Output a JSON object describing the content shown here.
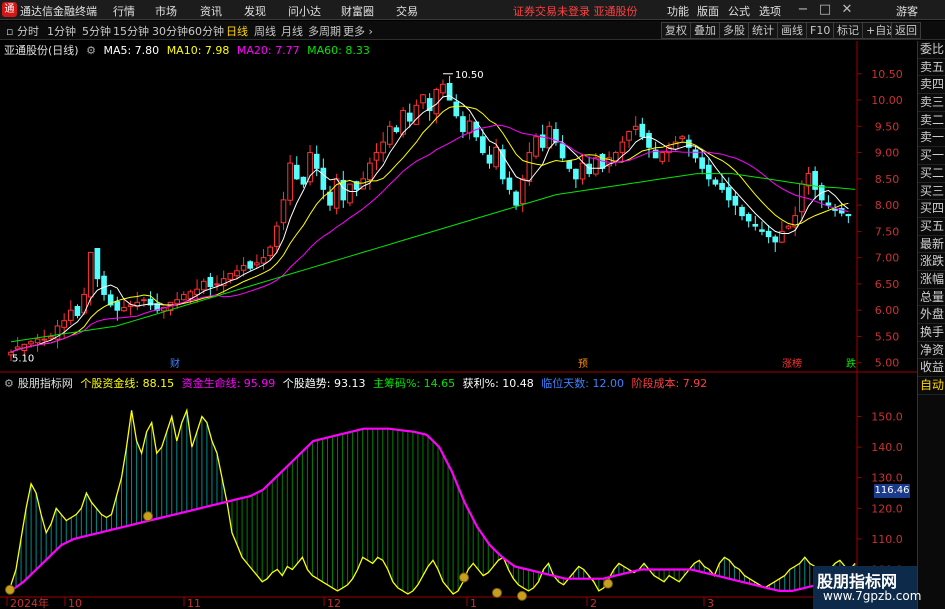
{
  "app": {
    "title": "通达信金融终端",
    "logo": "通"
  },
  "menu": [
    "行情",
    "市场",
    "资讯",
    "发现",
    "问小达",
    "财富圈",
    "交易"
  ],
  "login_warning": "证券交易未登录  亚通股份",
  "right_menu": [
    "功能",
    "版面",
    "公式",
    "选项"
  ],
  "guest": "游客",
  "window_icons": [
    "minimize-icon",
    "maximize-icon",
    "close-icon"
  ],
  "periods": [
    "分时",
    "1分钟",
    "5分钟",
    "15分钟",
    "30分钟",
    "60分钟",
    "日线",
    "周线",
    "月线",
    "多周期",
    "更多"
  ],
  "active_period": "日线",
  "toolbar": [
    "复权",
    "叠加",
    "多股",
    "统计",
    "画线",
    "F10",
    "标记",
    "+自选",
    "返回"
  ],
  "main_header": {
    "stock": "亚通股份",
    "period": "(日线)",
    "ma5": "MA5: 7.80",
    "ma10": "MA10: 7.98",
    "ma20": "MA20: 7.77",
    "ma60": "MA60: 8.33"
  },
  "colors": {
    "up": "#ff3232",
    "down": "#54fcfc",
    "ma5": "#ffffff",
    "ma10": "#ffff00",
    "ma20": "#ff00ff",
    "ma60": "#00e600"
  },
  "indicator_header": {
    "name": "股朋指标网",
    "f1": "个股资金线: 88.15",
    "f2": "资金生命线: 95.99",
    "f3": "个股趋势: 93.13",
    "f4": "主筹码%: 14.65",
    "f5": "获利%: 10.48",
    "f6": "临位天数: 12.00",
    "f7": "阶段成本: 7.92"
  },
  "right_panel": [
    "委比",
    "卖五",
    "卖四",
    "卖三",
    "卖二",
    "卖一",
    "买一",
    "买二",
    "买三",
    "买四",
    "买五",
    "最新",
    "涨跌",
    "涨幅",
    "总量",
    "外盘",
    "换手",
    "净资",
    "收益",
    "自动"
  ],
  "price_ticks": [
    "10.50",
    "10.00",
    "9.50",
    "9.00",
    "8.50",
    "8.00",
    "7.50",
    "7.00",
    "6.50",
    "6.00",
    "5.50",
    "5.00"
  ],
  "indicator_ticks": [
    "150.0",
    "140.0",
    "130.0",
    "120.0",
    "110.0",
    "100.0"
  ],
  "indicator_price_tag": "116.46",
  "date_labels": [
    "2024年",
    "10",
    "11",
    "12",
    "1",
    "2",
    "3"
  ],
  "annotations": {
    "high": "10.50",
    "low": "5.10",
    "cai": "财",
    "yu": "预",
    "zhangting": "涨榜",
    "die": "跌"
  },
  "watermark": {
    "line1": "股朋指标网",
    "line2": "www.7gpzb.com"
  },
  "chart_data": {
    "type": "candlestick",
    "ylim": [
      4.9,
      10.8
    ],
    "indicator_ylim": [
      92,
      158
    ],
    "closes": [
      5.2,
      5.3,
      5.35,
      5.4,
      5.45,
      5.45,
      5.5,
      5.7,
      5.8,
      6.0,
      5.9,
      6.3,
      7.1,
      6.6,
      6.3,
      6.1,
      6.0,
      6.05,
      6.1,
      6.15,
      6.2,
      6.1,
      6.0,
      6.05,
      6.15,
      6.2,
      6.3,
      6.35,
      6.4,
      6.55,
      6.45,
      6.5,
      6.6,
      6.7,
      6.75,
      6.85,
      6.8,
      6.9,
      7.0,
      7.2,
      7.6,
      8.1,
      8.8,
      8.5,
      8.4,
      9.0,
      8.7,
      8.3,
      8.0,
      8.5,
      8.1,
      8.4,
      8.3,
      8.5,
      8.8,
      9.0,
      9.2,
      9.5,
      9.4,
      9.8,
      9.6,
      9.9,
      10.1,
      9.8,
      10.2,
      10.3,
      10.0,
      9.7,
      9.4,
      9.6,
      9.3,
      9.0,
      8.8,
      9.1,
      8.5,
      8.3,
      8.0,
      8.5,
      9.0,
      9.3,
      9.1,
      9.5,
      9.2,
      8.9,
      8.7,
      8.5,
      8.8,
      8.6,
      8.9,
      8.7,
      8.9,
      9.0,
      9.2,
      9.4,
      9.5,
      9.3,
      9.1,
      8.9,
      9.0,
      9.1,
      9.2,
      9.3,
      9.1,
      8.9,
      8.7,
      8.5,
      8.4,
      8.3,
      8.1,
      8.0,
      7.8,
      7.7,
      7.6,
      7.5,
      7.4,
      7.3,
      7.5,
      7.6,
      7.8,
      8.4,
      8.6,
      8.3,
      8.1,
      8.0,
      7.9,
      7.85,
      7.8
    ],
    "ma60": [
      5.4,
      5.45,
      5.5,
      5.55,
      5.6,
      5.65,
      5.7,
      5.8,
      5.9,
      6.0,
      6.1,
      6.2,
      6.3,
      6.4,
      6.5,
      6.6,
      6.7,
      6.8,
      6.9,
      7.0,
      7.1,
      7.2,
      7.3,
      7.4,
      7.5,
      7.6,
      7.7,
      7.8,
      7.9,
      8.0,
      8.1,
      8.2,
      8.25,
      8.3,
      8.35,
      8.4,
      8.45,
      8.5,
      8.55,
      8.6,
      8.6,
      8.6,
      8.55,
      8.5,
      8.45,
      8.4,
      8.35,
      8.33,
      8.3
    ],
    "indicator_fund_line": [
      95,
      100,
      110,
      120,
      128,
      125,
      118,
      112,
      115,
      120,
      118,
      116,
      117,
      118,
      120,
      125,
      122,
      120,
      118,
      117,
      118,
      124,
      130,
      140,
      152,
      142,
      138,
      145,
      148,
      138,
      140,
      145,
      150,
      142,
      148,
      152,
      140,
      145,
      150,
      148,
      142,
      138,
      130,
      122,
      112,
      108,
      104,
      102,
      100,
      98,
      96,
      97,
      99,
      100,
      98,
      101,
      100,
      102,
      104,
      100,
      98,
      97,
      96,
      95,
      94,
      93,
      94,
      95,
      97,
      100,
      104,
      103,
      102,
      104,
      103,
      100,
      96,
      94,
      93,
      92,
      93,
      95,
      98,
      101,
      103,
      100,
      96,
      94,
      92,
      93,
      96,
      100,
      102,
      100,
      98,
      99,
      101,
      103,
      104,
      100,
      97,
      95,
      94,
      93,
      94,
      96,
      100,
      102,
      98,
      96,
      95,
      97,
      99,
      101,
      100,
      98,
      96,
      93,
      94,
      97,
      100,
      102,
      101,
      100,
      99,
      100,
      102,
      100,
      98,
      97,
      96,
      98,
      97,
      96,
      98,
      100,
      102,
      103,
      101,
      100,
      98,
      102,
      104,
      103,
      101,
      100,
      98,
      97,
      96,
      95,
      94,
      95,
      96,
      97,
      98,
      100,
      101,
      102,
      104,
      102,
      101,
      99,
      98,
      100,
      102,
      103,
      101,
      100,
      102
    ],
    "indicator_life_line": [
      93,
      96,
      100,
      104,
      108,
      110,
      111,
      112,
      113,
      114,
      115,
      116,
      117,
      118,
      119,
      120,
      121,
      122,
      123,
      124,
      126,
      130,
      134,
      138,
      142,
      143,
      144,
      145,
      146,
      146,
      146,
      145.5,
      145,
      144,
      140,
      132,
      122,
      114,
      108,
      104,
      101,
      100,
      99,
      98,
      97,
      97,
      97,
      97,
      98,
      99,
      100,
      100,
      100,
      100,
      100,
      99,
      98,
      97,
      96,
      95,
      94,
      93,
      93,
      94,
      95,
      97,
      99,
      101
    ],
    "series": [
      {
        "name": "MA5",
        "value": 7.8
      },
      {
        "name": "MA10",
        "value": 7.98
      },
      {
        "name": "MA20",
        "value": 7.77
      },
      {
        "name": "MA60",
        "value": 8.33
      }
    ]
  }
}
